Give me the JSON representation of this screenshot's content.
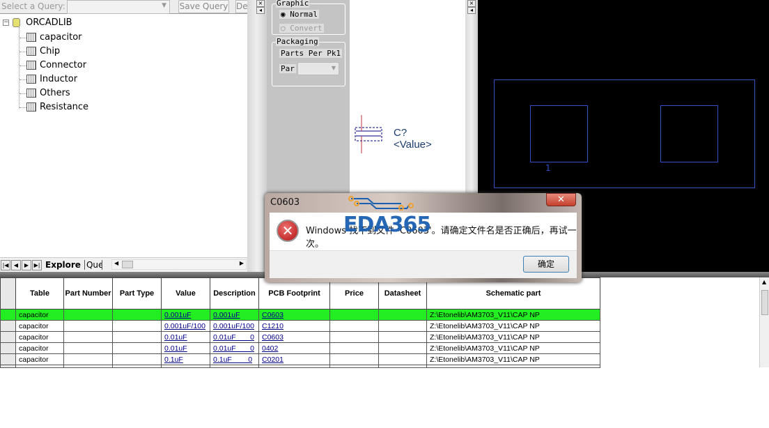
{
  "query_bar": {
    "label": "Select a Query:",
    "selected": "",
    "save_label": "Save Query",
    "delete_label": "De"
  },
  "tree": {
    "root": "ORCADLIB",
    "items": [
      "capacitor",
      "Chip",
      "Connector",
      "Inductor",
      "Others",
      "Resistance"
    ]
  },
  "bottom_tabs": {
    "active": "Explore",
    "other": "Que"
  },
  "props": {
    "graphic_title": "Graphic",
    "normal": "Normal",
    "convert": "Convert",
    "packaging_title": "Packaging",
    "parts_per_pkg": "Parts Per Pk",
    "parts_per_pkg_value": "1",
    "part_label": "Par"
  },
  "preview": {
    "refdes": "C?",
    "value": "<Value>"
  },
  "footprint": {
    "pin_label": "1"
  },
  "dialog": {
    "title": "C0603",
    "message": "Windows 找不到文件 'C0603'。请确定文件名是否正确后，再试一次。",
    "ok": "确定",
    "watermark": "EDA365"
  },
  "table": {
    "headers": [
      "Table",
      "Part Number",
      "Part Type",
      "Value",
      "Description",
      "PCB Footprint",
      "Price",
      "Datasheet",
      "Schematic part"
    ],
    "rows": [
      [
        "capacitor",
        "",
        "",
        "0.001uF",
        "0.001uF",
        "C0603",
        "",
        "",
        "Z:\\Etonelib\\AM3703_V11\\CAP NP"
      ],
      [
        "capacitor",
        "",
        "",
        "0.001uF/100",
        "0.001uF/100",
        "C1210",
        "",
        "",
        "Z:\\Etonelib\\AM3703_V11\\CAP NP"
      ],
      [
        "capacitor",
        "",
        "",
        "0.01uF",
        "0.01uF       0",
        "C0603",
        "",
        "",
        "Z:\\Etonelib\\AM3703_V11\\CAP NP"
      ],
      [
        "capacitor",
        "",
        "",
        "0.01uF",
        "0.01uF       0",
        "0402",
        "",
        "",
        "Z:\\Etonelib\\AM3703_V11\\CAP NP"
      ],
      [
        "capacitor",
        "",
        "",
        "0.1uF",
        "0.1uF        0",
        "C0201",
        "",
        "",
        "Z:\\Etonelib\\AM3703_V11\\CAP NP"
      ]
    ],
    "selected_color": "#22ee22"
  }
}
